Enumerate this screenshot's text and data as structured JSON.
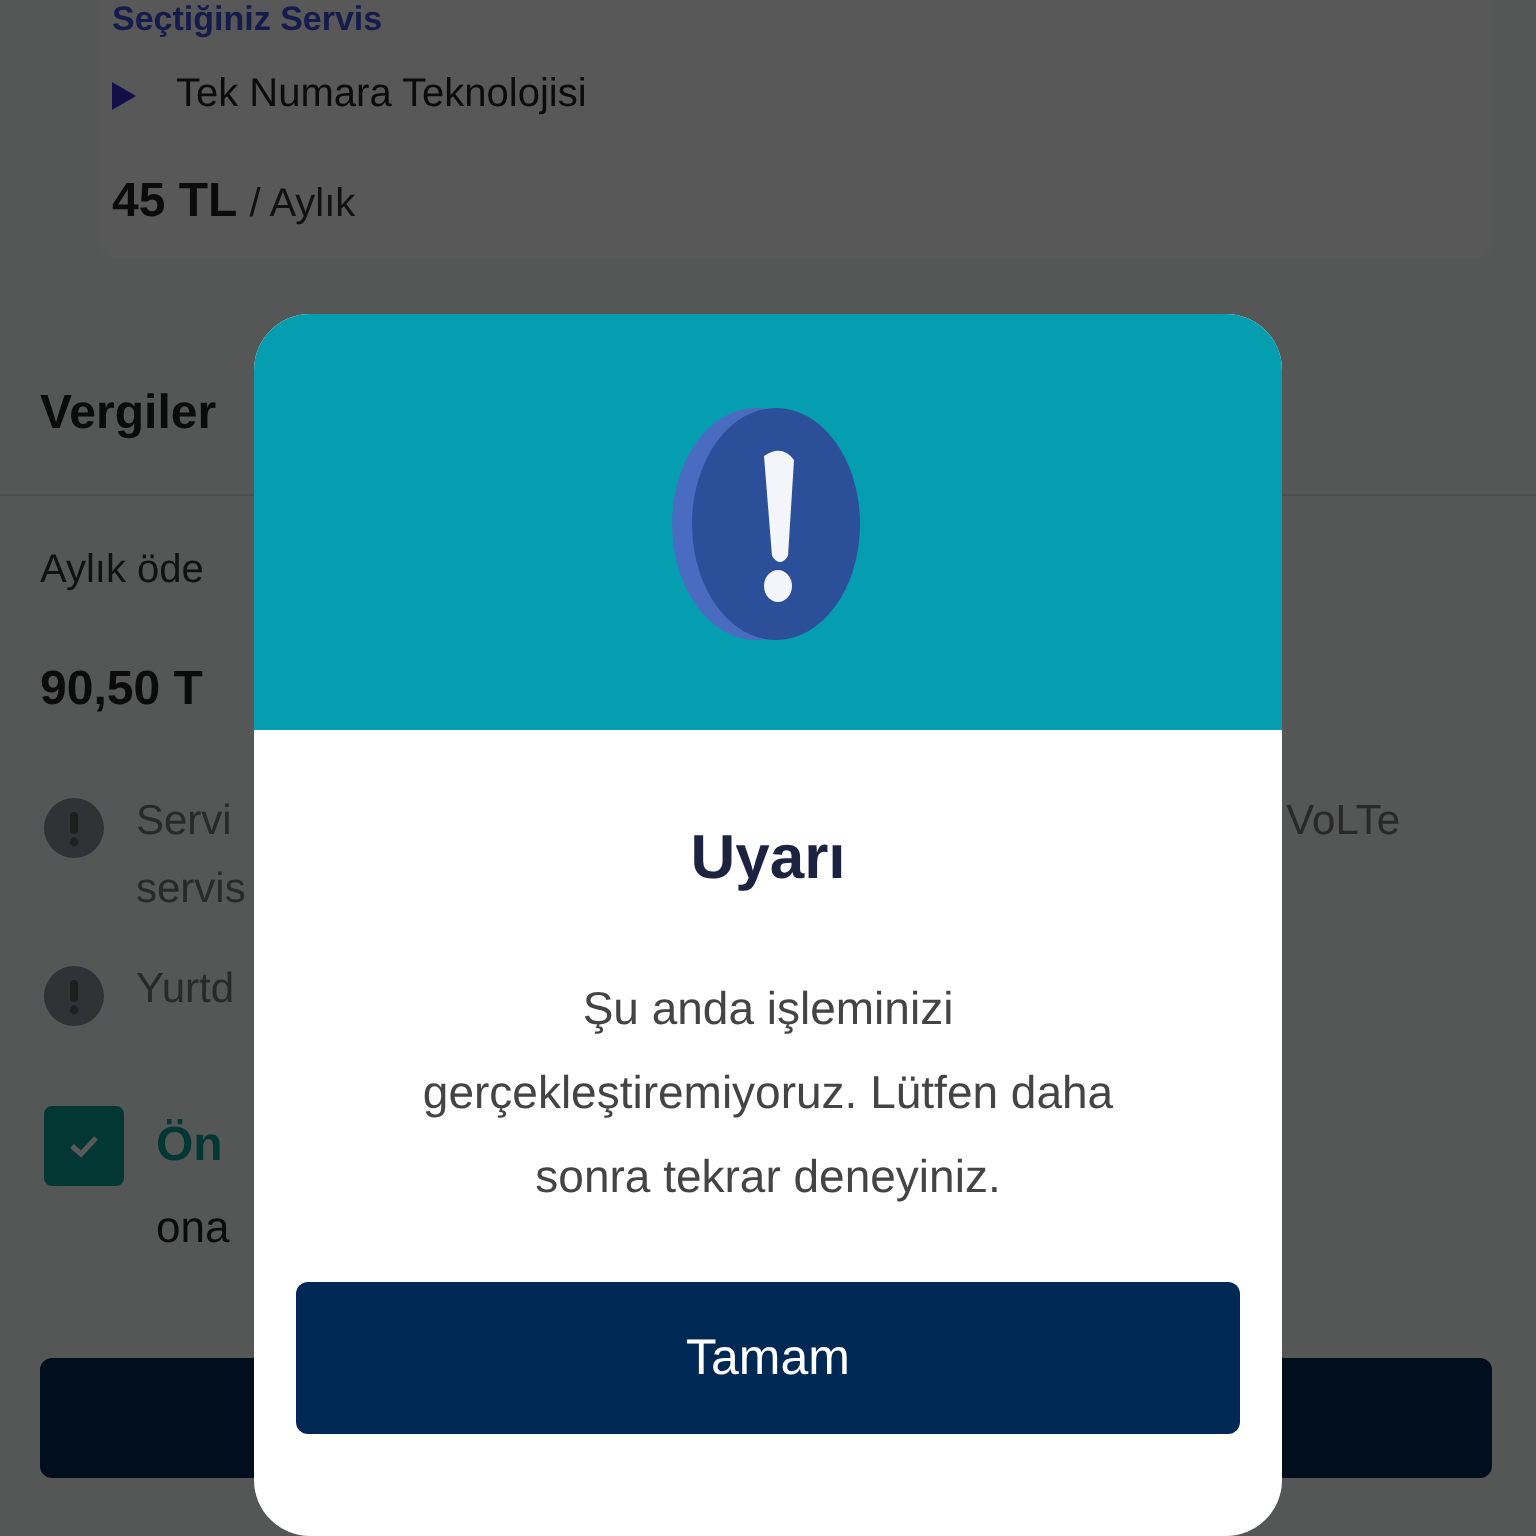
{
  "background": {
    "service_card": {
      "heading": "Seçtiğiniz Servis",
      "service": "Tek Numara Teknolojisi",
      "price": "45 TL",
      "period": "/ Aylık"
    },
    "taxes_heading": "Vergiler",
    "monthly_label": "Aylık öde",
    "monthly_amount": "90,50 T",
    "notes": [
      {
        "lines": [
          "Servi",
          "servis"
        ],
        "trailing": "VoLTe"
      },
      {
        "lines": [
          "Yurtd"
        ]
      }
    ],
    "consent": {
      "checked": true,
      "title": "Ön",
      "text": "ona"
    }
  },
  "dialog": {
    "title": "Uyarı",
    "message": "Şu anda işleminizi gerçekleştiremiyoruz. Lütfen daha sonra tekrar deneyiniz.",
    "button": "Tamam"
  }
}
